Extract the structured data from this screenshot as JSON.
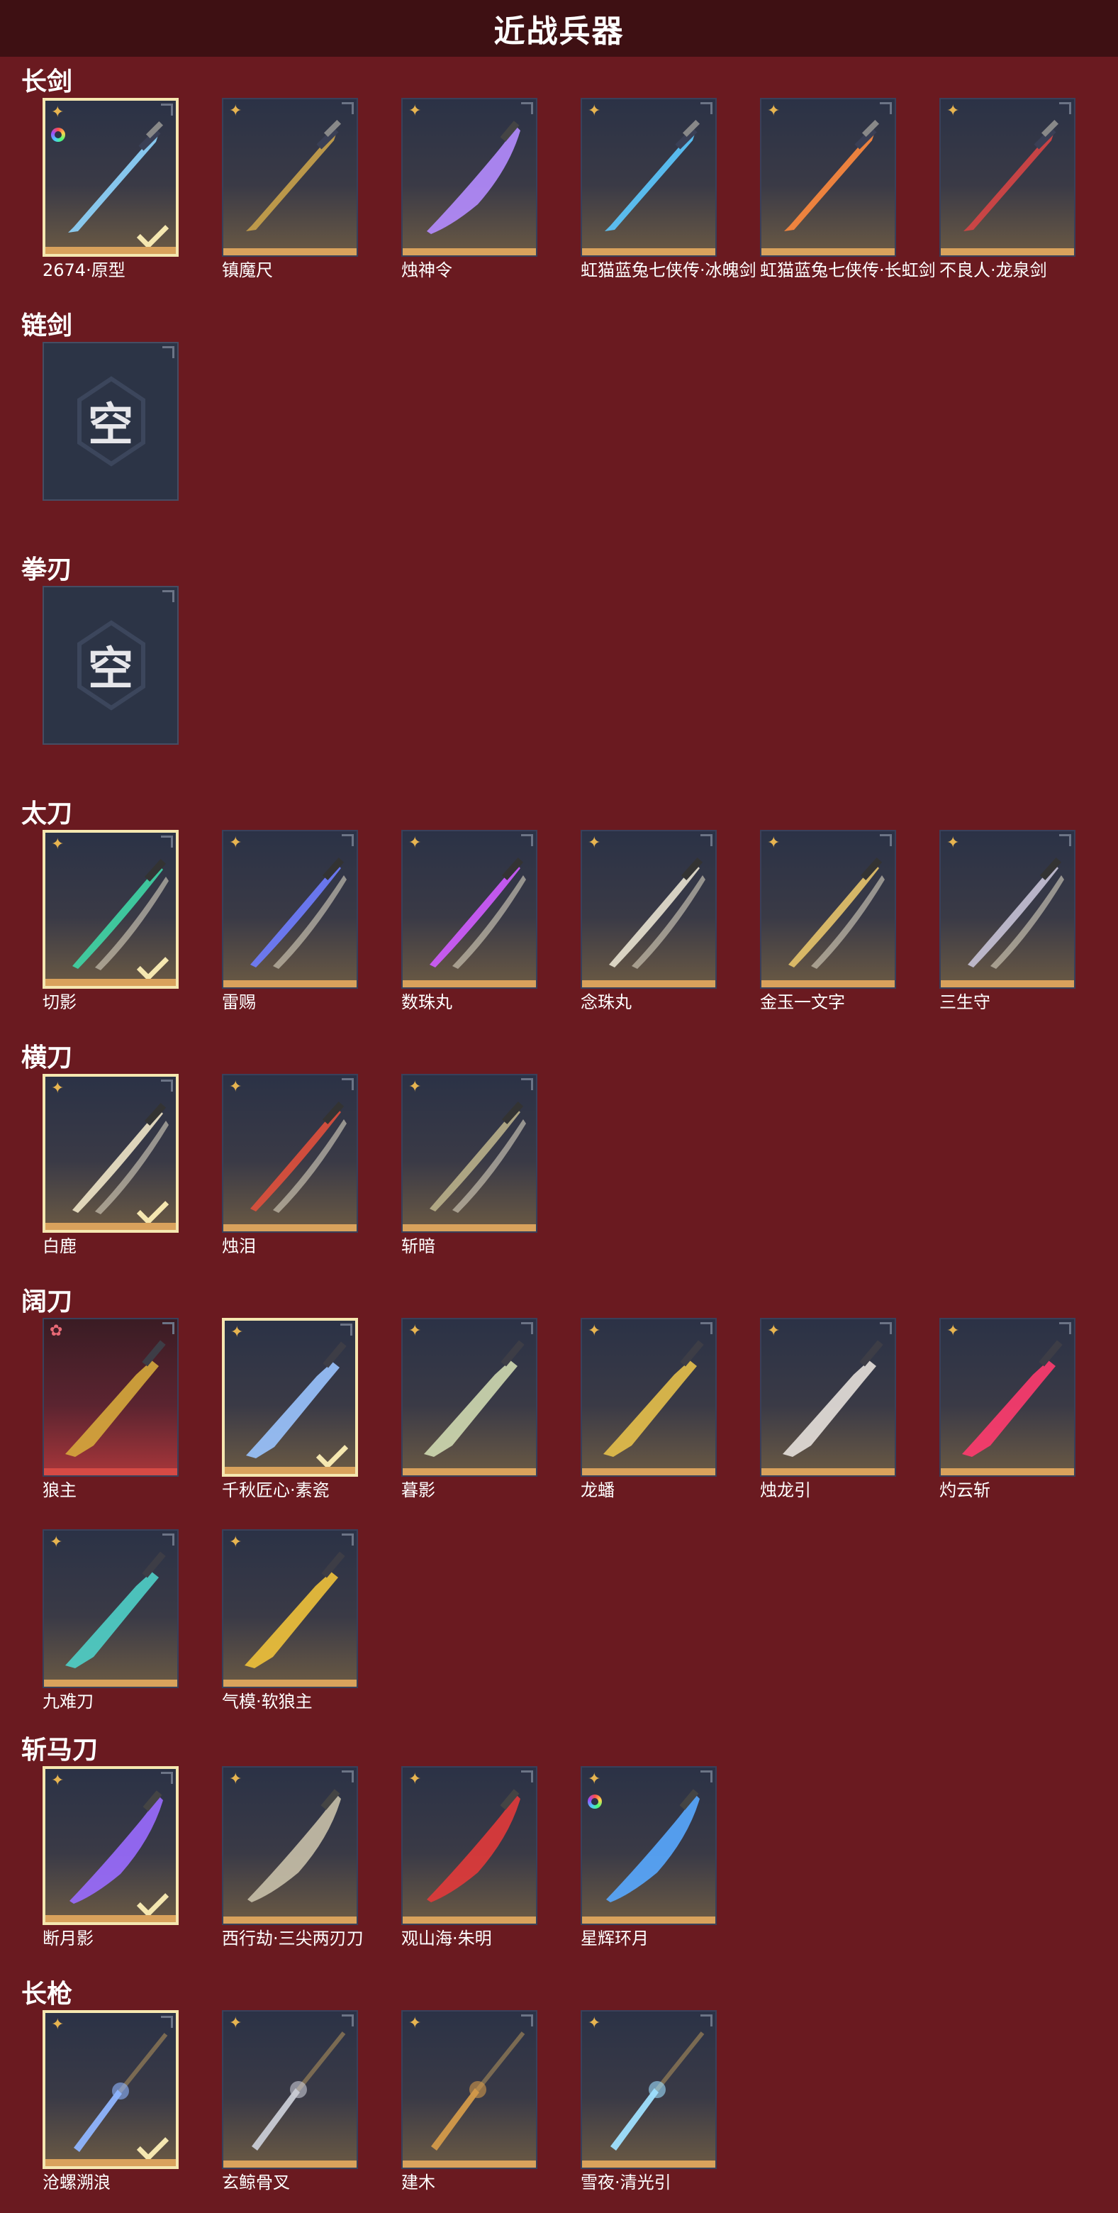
{
  "header": {
    "title": "近战兵器"
  },
  "sections": [
    {
      "id": "sword",
      "title": "长剑",
      "items": [
        {
          "name": "2674·原型",
          "selected": true,
          "rarity": "gold",
          "ring": true,
          "color": "#8fd6ff",
          "shape": "sword"
        },
        {
          "name": "镇魔尺",
          "selected": false,
          "rarity": "gold",
          "color": "#c9a24a",
          "shape": "sword"
        },
        {
          "name": "烛神令",
          "selected": false,
          "rarity": "gold",
          "color": "#b58cff",
          "shape": "curved"
        },
        {
          "name": "虹猫蓝兔七侠传·冰魄剑",
          "selected": false,
          "rarity": "gold",
          "color": "#5cc9ff",
          "shape": "sword"
        },
        {
          "name": "虹猫蓝兔七侠传·长虹剑",
          "selected": false,
          "rarity": "gold",
          "color": "#ff8a3d",
          "shape": "sword"
        },
        {
          "name": "不良人·龙泉剑",
          "selected": false,
          "rarity": "gold",
          "color": "#d64545",
          "shape": "sword"
        }
      ]
    },
    {
      "id": "chain-sword",
      "title": "链剑",
      "items": [
        {
          "empty": true,
          "name": "",
          "glyph": "空"
        }
      ]
    },
    {
      "id": "fist-blade",
      "title": "拳刃",
      "items": [
        {
          "empty": true,
          "name": "",
          "glyph": "空"
        }
      ]
    },
    {
      "id": "katana",
      "title": "太刀",
      "items": [
        {
          "name": "切影",
          "selected": true,
          "rarity": "gold",
          "color": "#3fd6a6",
          "shape": "katana"
        },
        {
          "name": "雷赐",
          "selected": false,
          "rarity": "gold",
          "color": "#6f7dff",
          "shape": "katana"
        },
        {
          "name": "数珠丸",
          "selected": false,
          "rarity": "gold",
          "color": "#d05cff",
          "shape": "katana"
        },
        {
          "name": "念珠丸",
          "selected": false,
          "rarity": "gold",
          "color": "#e8e2d0",
          "shape": "katana"
        },
        {
          "name": "金玉一文字",
          "selected": false,
          "rarity": "gold",
          "color": "#e7c46a",
          "shape": "katana"
        },
        {
          "name": "三生守",
          "selected": false,
          "rarity": "gold",
          "color": "#c7c2d6",
          "shape": "katana"
        }
      ]
    },
    {
      "id": "saber",
      "title": "横刀",
      "items": [
        {
          "name": "白鹿",
          "selected": true,
          "rarity": "gold",
          "color": "#efe6c8",
          "shape": "katana"
        },
        {
          "name": "烛泪",
          "selected": false,
          "rarity": "gold",
          "color": "#e0503c",
          "shape": "katana"
        },
        {
          "name": "斩暗",
          "selected": false,
          "rarity": "gold",
          "color": "#b9b08a",
          "shape": "katana"
        }
      ]
    },
    {
      "id": "broadblade",
      "title": "阔刀",
      "items": [
        {
          "name": "狼主",
          "selected": false,
          "rarity": "red",
          "color": "#d6a93c",
          "shape": "broad"
        },
        {
          "name": "千秋匠心·素瓷",
          "selected": true,
          "rarity": "gold",
          "color": "#9ac4ff",
          "shape": "broad"
        },
        {
          "name": "暮影",
          "selected": false,
          "rarity": "gold",
          "color": "#cfd9b0",
          "shape": "broad"
        },
        {
          "name": "龙蟠",
          "selected": false,
          "rarity": "gold",
          "color": "#e6c04a",
          "shape": "broad"
        },
        {
          "name": "烛龙引",
          "selected": false,
          "rarity": "gold",
          "color": "#e6e0da",
          "shape": "broad"
        },
        {
          "name": "灼云斩",
          "selected": false,
          "rarity": "gold",
          "color": "#ff3b6e",
          "shape": "broad"
        },
        {
          "name": "九难刀",
          "selected": false,
          "rarity": "gold",
          "color": "#4fd0c8",
          "shape": "broad"
        },
        {
          "name": "气模·软狼主",
          "selected": false,
          "rarity": "gold",
          "color": "#f0c23a",
          "shape": "broad"
        }
      ]
    },
    {
      "id": "zhanmadao",
      "title": "斩马刀",
      "items": [
        {
          "name": "断月影",
          "selected": true,
          "rarity": "gold",
          "color": "#9a6bff",
          "shape": "curved"
        },
        {
          "name": "西行劫·三尖两刃刀",
          "selected": false,
          "rarity": "gold",
          "color": "#c8c0a8",
          "shape": "curved"
        },
        {
          "name": "观山海·朱明",
          "selected": false,
          "rarity": "gold",
          "color": "#e23a3a",
          "shape": "curved"
        },
        {
          "name": "星辉环月",
          "selected": false,
          "rarity": "gold",
          "ring": true,
          "color": "#58a8ff",
          "shape": "curved"
        }
      ]
    },
    {
      "id": "spear",
      "title": "长枪",
      "items": [
        {
          "name": "沧螺溯浪",
          "selected": true,
          "rarity": "gold",
          "color": "#8fb5ff",
          "shape": "spear"
        },
        {
          "name": "玄鲸骨叉",
          "selected": false,
          "rarity": "gold",
          "color": "#c9ccd6",
          "shape": "spear"
        },
        {
          "name": "建木",
          "selected": false,
          "rarity": "gold",
          "color": "#d39a4a",
          "shape": "spear"
        },
        {
          "name": "雪夜·清光引",
          "selected": false,
          "rarity": "gold",
          "color": "#9fe0ff",
          "shape": "spear"
        }
      ]
    }
  ]
}
